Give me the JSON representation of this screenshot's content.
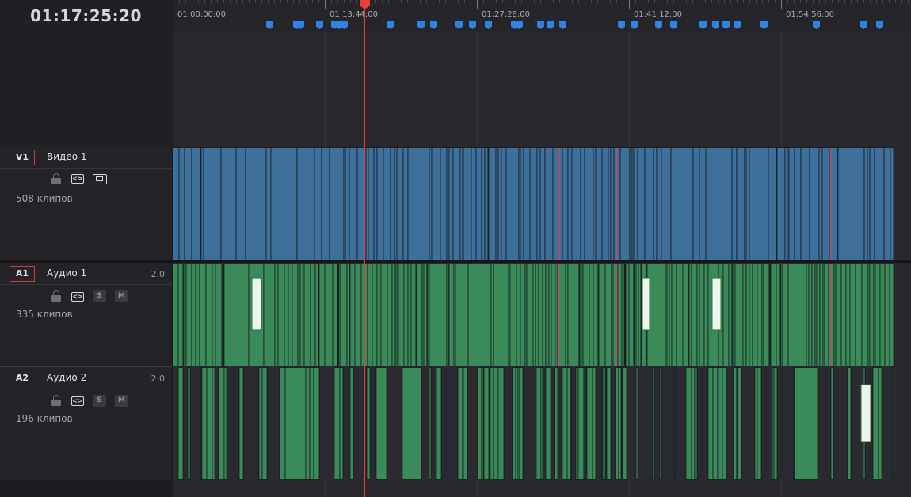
{
  "timecode": "01:17:25:20",
  "ruler": {
    "ticks": [
      "01:00:00:00",
      "01:13:44:00",
      "01:27:28:00",
      "01:41:12:00",
      "01:54:56:00"
    ]
  },
  "markers_count": 31,
  "tracks": [
    {
      "id": "V1",
      "name": "Видео 1",
      "channels": "",
      "clips": "508 клипов",
      "controls": [
        "lock-icon",
        "link-icon",
        "film-icon"
      ]
    },
    {
      "id": "A1",
      "name": "Аудио 1",
      "channels": "2.0",
      "clips": "335 клипов",
      "controls": [
        "lock-icon",
        "link-icon",
        "S",
        "M"
      ]
    },
    {
      "id": "A2",
      "name": "Аудио 2",
      "channels": "2.0",
      "clips": "196 клипов",
      "controls": [
        "lock-icon",
        "link-icon",
        "S",
        "M"
      ]
    }
  ],
  "colors": {
    "video_clip": "#3f6f9b",
    "audio_clip": "#3b8a5a",
    "marker": "#2e84e0",
    "playhead": "#e4403a",
    "selected_track_border": "#cc3f3f"
  }
}
